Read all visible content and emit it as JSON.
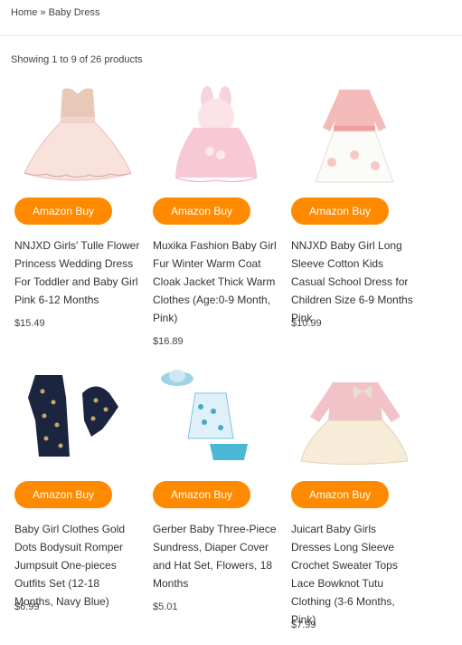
{
  "breadcrumb": {
    "home": "Home",
    "separator": " » ",
    "current": "Baby Dress"
  },
  "result_count": "Showing 1 to 9 of 26 products",
  "buy_label": "Amazon Buy",
  "accent_color": "#ff8a00",
  "products": [
    {
      "title": "NNJXD Girls' Tulle Flower Princess Wedding Dress For Toddler and Baby Girl Pink 6-12 Months",
      "price": "$15.49",
      "image_icon": "pink-tulle-dress-image"
    },
    {
      "title": "Muxika Fashion Baby Girl Fur Winter Warm Coat Cloak Jacket Thick Warm Clothes (Age:0-9 Month, Pink)",
      "price": "$16.89",
      "image_icon": "pink-fur-coat-image"
    },
    {
      "title": "NNJXD Baby Girl Long Sleeve Cotton Kids Casual School Dress for Children Size 6-9 Months Pink",
      "price": "$10.99",
      "image_icon": "pink-long-sleeve-dress-image"
    },
    {
      "title": "Baby Girl Clothes Gold Dots Bodysuit Romper Jumpsuit One-pieces Outfits Set (12-18 Months, Navy Blue)",
      "price": "$6.99",
      "image_icon": "navy-dot-romper-image"
    },
    {
      "title": "Gerber Baby Three-Piece Sundress, Diaper Cover and Hat Set, Flowers, 18 Months",
      "price": "$5.01",
      "image_icon": "floral-sundress-set-image"
    },
    {
      "title": "Juicart Baby Girls Dresses Long Sleeve Crochet Sweater Tops Lace Bowknot Tutu Clothing (3-6 Months, Pink)",
      "price": "$7.99",
      "image_icon": "pink-sweater-tutu-dress-image"
    }
  ]
}
